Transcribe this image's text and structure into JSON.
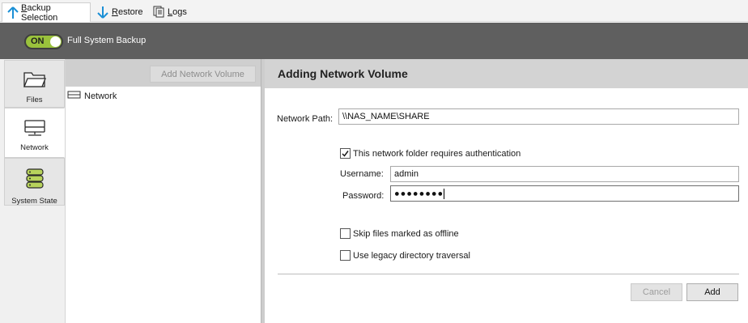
{
  "tabs": [
    {
      "label": "Backup Selection",
      "icon": "arrow-up-icon",
      "active": true
    },
    {
      "label": "Restore",
      "icon": "arrow-down-icon",
      "active": false
    },
    {
      "label": "Logs",
      "icon": "logs-icon",
      "active": false
    }
  ],
  "header": {
    "toggle_label": "ON",
    "toggle_state": true,
    "title": "Full System Backup",
    "accent": "#9ac23c"
  },
  "nav": {
    "items": [
      {
        "label": "Files",
        "icon": "folder-icon",
        "active": false
      },
      {
        "label": "Network",
        "icon": "network-drive-icon",
        "active": true
      },
      {
        "label": "System State",
        "icon": "server-stack-icon",
        "active": false
      }
    ]
  },
  "tree": {
    "add_button_label": "Add Network Volume",
    "items": [
      {
        "label": "Network",
        "icon": "network-drive-icon"
      }
    ]
  },
  "form": {
    "title": "Adding Network Volume",
    "network_path_label": "Network Path:",
    "network_path_value": "\\\\NAS_NAME\\SHARE",
    "auth_checkbox_label": "This network folder requires authentication",
    "auth_checked": true,
    "username_label": "Username:",
    "username_value": "admin",
    "password_label": "Password:",
    "password_value": "●●●●●●●●",
    "skip_offline_label": "Skip files marked as offline",
    "skip_offline_checked": false,
    "legacy_traversal_label": "Use legacy directory traversal",
    "legacy_traversal_checked": false,
    "cancel_label": "Cancel",
    "add_label": "Add"
  }
}
